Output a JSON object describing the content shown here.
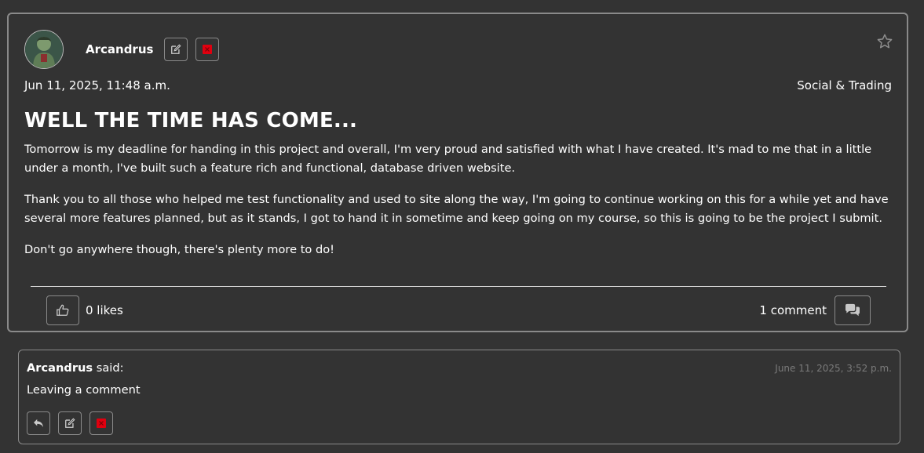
{
  "post": {
    "author": "Arcandrus",
    "date": "Jun 11, 2025, 11:48 a.m.",
    "category": "Social & Trading",
    "title": "WELL THE TIME HAS COME...",
    "paragraphs": [
      "Tomorrow is my deadline for handing in this project and overall, I'm very proud and satisfied with what I have created. It's mad to me that in a little under a month, I've built such a feature rich and functional, database driven website.",
      "Thank you to all those who helped me test functionality and used to site along the way, I'm going to continue working on this for a while yet and have several more features planned, but as it stands, I got to hand it in sometime and keep going on my course, so this is going to be the project I submit.",
      "Don't go anywhere though, there's plenty more to do!"
    ],
    "likes_label": "0 likes",
    "comments_label": "1 comment"
  },
  "comment": {
    "author": "Arcandrus",
    "said_label": "said:",
    "date": "June 11, 2025, 3:52 p.m.",
    "text": "Leaving a comment"
  },
  "icons": {
    "edit": "edit-icon",
    "delete": "delete-icon",
    "favorite": "star-icon",
    "like": "thumbs-up-icon",
    "comments": "comments-icon",
    "reply": "reply-icon"
  },
  "colors": {
    "background": "#333333",
    "border": "#8a8a8a",
    "delete_red": "#e0000f",
    "muted_text": "#7a7a7a"
  }
}
